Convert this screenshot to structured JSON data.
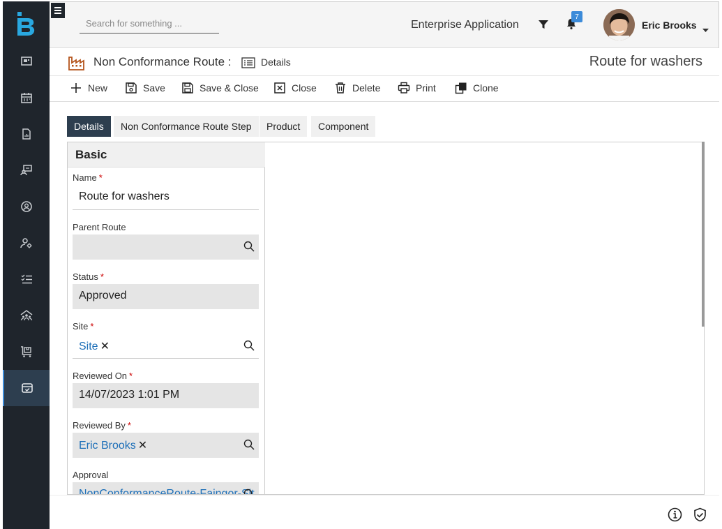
{
  "header": {
    "search_placeholder": "Search for something ...",
    "app_name": "Enterprise Application",
    "notification_count": "7",
    "user_name": "Eric Brooks"
  },
  "nav": {
    "items": [
      "dashboard-icon",
      "calendar-icon",
      "report-icon",
      "desk-icon",
      "user-circle-icon",
      "user-settings-icon",
      "checklist-icon",
      "team-icon",
      "cart-icon",
      "inventory-box-icon"
    ],
    "active_index": 9
  },
  "titlebar": {
    "entity": "Non Conformance Route :",
    "view": "Details",
    "record_title": "Route for washers"
  },
  "toolbar": {
    "new": "New",
    "save": "Save",
    "save_close": "Save & Close",
    "close": "Close",
    "delete": "Delete",
    "print": "Print",
    "clone": "Clone"
  },
  "tabs": [
    "Details",
    "Non Conformance Route Step",
    "Product",
    "Component"
  ],
  "form": {
    "section": "Basic",
    "name_label": "Name",
    "name_value": "Route for washers",
    "parent_label": "Parent Route",
    "parent_value": "",
    "status_label": "Status",
    "status_value": "Approved",
    "site_label": "Site",
    "site_value": "Site",
    "reviewed_on_label": "Reviewed On",
    "reviewed_on_value": "14/07/2023 1:01 PM",
    "reviewed_by_label": "Reviewed By",
    "reviewed_by_value": "Eric Brooks",
    "approval_label": "Approval",
    "approval_value": "NonConformanceRoute-Faingor-Sit"
  },
  "colors": {
    "sidebar": "#1f252c",
    "accent": "#2d3e4f",
    "link": "#1d6fb8",
    "required": "#cc0000"
  }
}
